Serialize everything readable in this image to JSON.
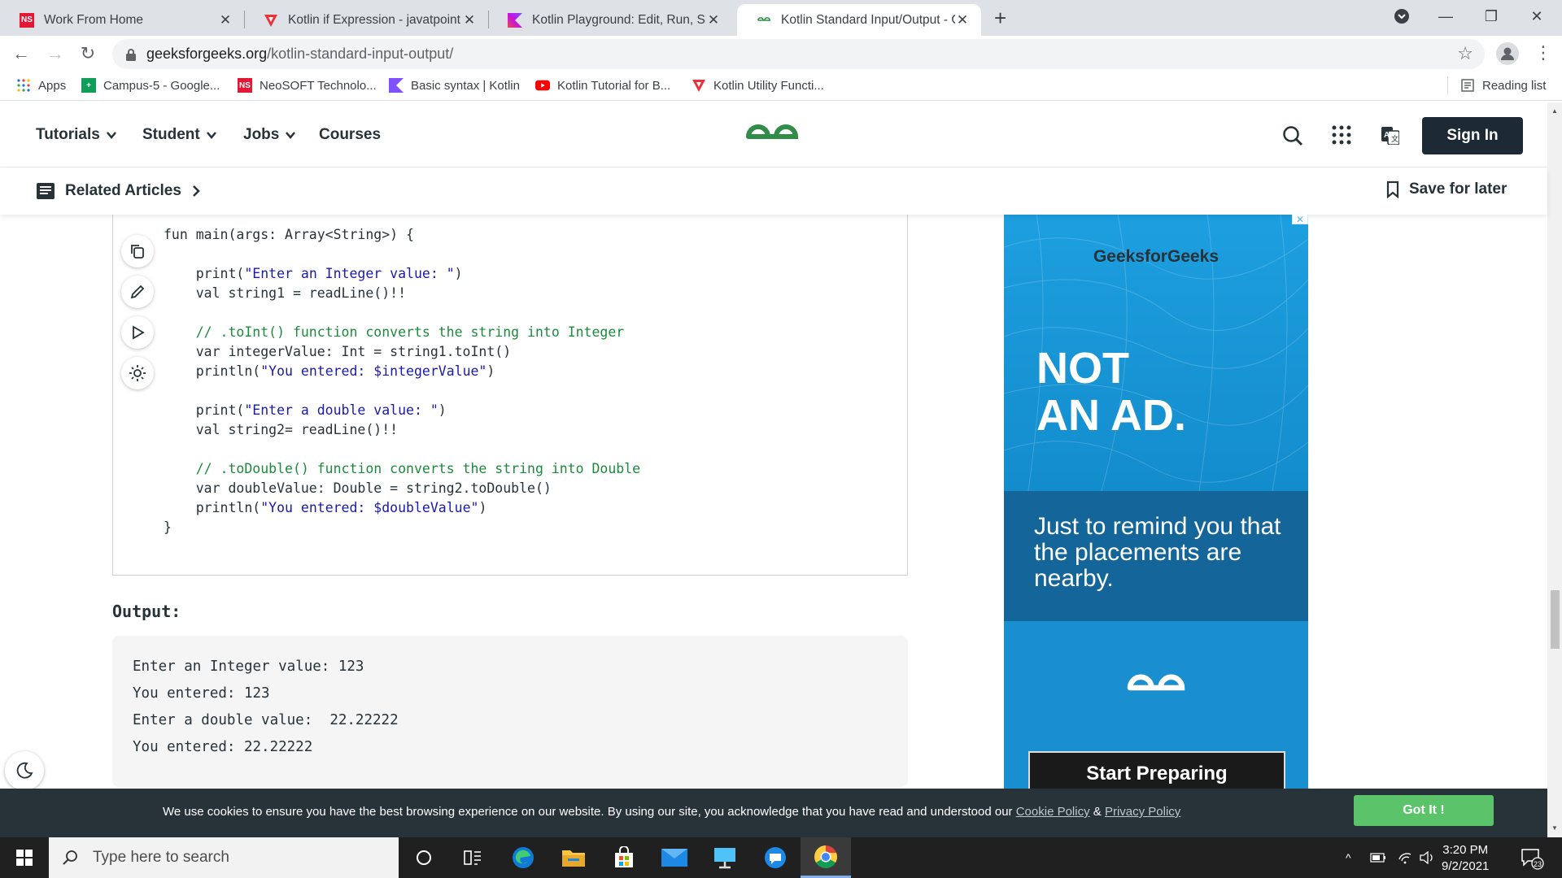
{
  "browser": {
    "tabs": [
      {
        "title": "Work From Home",
        "favicon": "NS",
        "favicon_color": "#e31837",
        "active": false
      },
      {
        "title": "Kotlin if Expression - javatpoint",
        "favicon": "V",
        "favicon_color": "#e8323c",
        "active": false
      },
      {
        "title": "Kotlin Playground: Edit, Run, Shar",
        "favicon": "K",
        "favicon_color": "#7f52ff",
        "active": false
      },
      {
        "title": "Kotlin Standard Input/Output - G",
        "favicon": "GG",
        "favicon_color": "#2f8d46",
        "active": true
      }
    ],
    "url_domain": "geeksforgeeks.org",
    "url_path": "/kotlin-standard-input-output/",
    "bookmarks": [
      {
        "label": "Apps",
        "icon": "apps-grid-icon"
      },
      {
        "label": "Campus-5 - Google...",
        "icon": "google-sheets-icon"
      },
      {
        "label": "NeoSOFT Technolo...",
        "icon": "neosoft-icon"
      },
      {
        "label": "Basic syntax | Kotlin",
        "icon": "kotlin-icon"
      },
      {
        "label": "Kotlin Tutorial for B...",
        "icon": "youtube-icon"
      },
      {
        "label": "Kotlin Utility Functi...",
        "icon": "javatpoint-icon"
      }
    ],
    "reading_list": "Reading list"
  },
  "site": {
    "nav": [
      "Tutorials",
      "Student",
      "Jobs",
      "Courses"
    ],
    "sign_in": "Sign In",
    "related_articles": "Related Articles",
    "save_for_later": "Save for later",
    "brand_color": "#2f8d46"
  },
  "code": [
    [
      {
        "t": "fun main(args: Array<String>) {",
        "c": "p"
      }
    ],
    [
      {
        "t": "",
        "c": "p"
      }
    ],
    [
      {
        "t": "    print(",
        "c": "p"
      },
      {
        "t": "\"Enter an Integer value: \"",
        "c": "s"
      },
      {
        "t": ")",
        "c": "p"
      }
    ],
    [
      {
        "t": "    val string1 = readLine()!!",
        "c": "p"
      }
    ],
    [
      {
        "t": "",
        "c": "p"
      }
    ],
    [
      {
        "t": "    // .toInt() function converts the string into Integer",
        "c": "c"
      }
    ],
    [
      {
        "t": "    var integerValue: Int = string1.toInt()",
        "c": "p"
      }
    ],
    [
      {
        "t": "    println(",
        "c": "p"
      },
      {
        "t": "\"You entered: $integerValue\"",
        "c": "s"
      },
      {
        "t": ")",
        "c": "p"
      }
    ],
    [
      {
        "t": "",
        "c": "p"
      }
    ],
    [
      {
        "t": "    print(",
        "c": "p"
      },
      {
        "t": "\"Enter a double value: \"",
        "c": "s"
      },
      {
        "t": ")",
        "c": "p"
      }
    ],
    [
      {
        "t": "    val string2= readLine()!!",
        "c": "p"
      }
    ],
    [
      {
        "t": "",
        "c": "p"
      }
    ],
    [
      {
        "t": "    // .toDouble() function converts the string into Double",
        "c": "c"
      }
    ],
    [
      {
        "t": "    var doubleValue: Double = string2.toDouble()",
        "c": "p"
      }
    ],
    [
      {
        "t": "    println(",
        "c": "p"
      },
      {
        "t": "\"You entered: $doubleValue\"",
        "c": "s"
      },
      {
        "t": ")",
        "c": "p"
      }
    ],
    [
      {
        "t": "}",
        "c": "p"
      }
    ]
  ],
  "output": {
    "label": "Output:",
    "lines": [
      "Enter an Integer value: 123",
      "You entered: 123",
      "Enter a double value:  22.22222",
      "You entered: 22.22222"
    ]
  },
  "ad": {
    "brand": "GeeksforGeeks",
    "headline_1": "NOT",
    "headline_2": "AN AD.",
    "body": "Just to remind you that the placements are nearby.",
    "button": "Start Preparing"
  },
  "cookie": {
    "text": "We use cookies to ensure you have the best browsing experience on our website. By using our site, you acknowledge that you have read and understood our ",
    "cookie_policy": "Cookie Policy",
    "amp": " & ",
    "privacy_policy": "Privacy Policy",
    "button": "Got It !"
  },
  "taskbar": {
    "search_placeholder": "Type here to search",
    "time": "3:20 PM",
    "date": "9/2/2021",
    "notifications": "23"
  }
}
